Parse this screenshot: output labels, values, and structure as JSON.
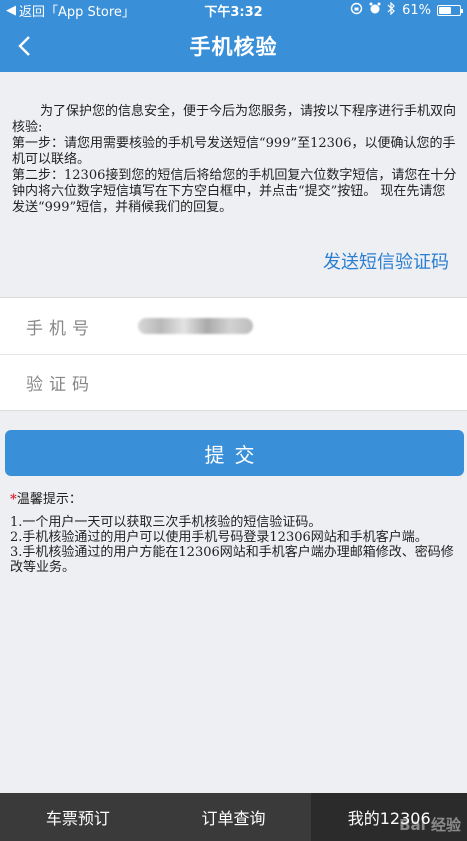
{
  "status_bar": {
    "back_label": "返回「App Store」",
    "time": "下午3:32",
    "battery_percent": "61%",
    "battery_level": 0.61
  },
  "nav": {
    "title": "手机核验"
  },
  "intro": {
    "paragraph": "为了保护您的信息安全，便于今后为您服务，请按以下程序进行手机双向核验:",
    "step1": "第一步：请您用需要核验的手机号发送短信“999”至12306，以便确认您的手机可以联络。",
    "step2": "第二步：12306接到您的短信后将给您的手机回复六位数字短信，请您在十分钟内将六位数字短信填写在下方空白框中，并点击“提交”按钮。 现在先请您发送“999”短信，并稍候我们的回复。"
  },
  "send_code_label": "发送短信验证码",
  "form": {
    "phone_label": "手机号",
    "code_label": "验证码"
  },
  "submit_label": "提交",
  "tips": {
    "star": "*",
    "title": "温馨提示：",
    "items": [
      "1.一个用户一天可以获取三次手机核验的短信验证码。",
      "2.手机核验通过的用户可以使用手机号码登录12306网站和手机客户端。",
      "3.手机核验通过的用户方能在12306网站和手机客户端办理邮箱修改、密码修改等业务。"
    ]
  },
  "tabs": [
    {
      "label": "车票预订"
    },
    {
      "label": "订单查询"
    },
    {
      "label": "我的12306"
    }
  ],
  "watermark": "Bai 经验",
  "colors": {
    "primary": "#3a8fd9",
    "link": "#2a7fd0",
    "tab_bar": "#3a3a3a",
    "tip_star": "#d9232d"
  }
}
